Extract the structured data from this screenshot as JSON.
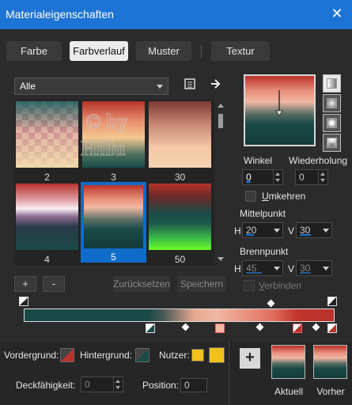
{
  "window": {
    "title": "Materialeigenschaften",
    "close_glyph": "✕"
  },
  "tabs": [
    {
      "label": "Farbe"
    },
    {
      "label": "Farbverlauf",
      "active": true
    },
    {
      "label": "Muster"
    },
    {
      "label": "Textur"
    }
  ],
  "category_select": {
    "value": "Alle"
  },
  "gallery": {
    "items": [
      {
        "label": "2"
      },
      {
        "label": "3"
      },
      {
        "label": "30"
      },
      {
        "label": "4"
      },
      {
        "label": "5",
        "selected": true
      },
      {
        "label": "50"
      }
    ],
    "watermark": "© by Hillu"
  },
  "buttons": {
    "add": "+",
    "remove": "-",
    "reset": "Zurücksetzen",
    "save": "Speichern"
  },
  "angle": {
    "label": "Winkel",
    "value": "0"
  },
  "repeat": {
    "label": "Wiederholung",
    "value": "0"
  },
  "invert": {
    "label": "Umkehren",
    "underline_char": "U",
    "rest": "mkehren"
  },
  "midpoint": {
    "label": "Mittelpunkt",
    "h_label": "H",
    "h_value": "20",
    "v_label": "V",
    "v_value": "30"
  },
  "focus": {
    "label": "Brennpunkt",
    "h_label": "H",
    "h_value": "45",
    "v_label": "V",
    "v_value": "30"
  },
  "link": {
    "label": "Verbinden",
    "underline_char": "V",
    "rest": "erbinden"
  },
  "bottom": {
    "foreground_label": "Vordergrund:",
    "background_label": "Hintergrund:",
    "user_label": "Nutzer:",
    "opacity_label": "Deckfähigkeit:",
    "opacity_value": "0",
    "position_label": "Position:",
    "position_value": "0",
    "current_label": "Aktuell",
    "previous_label": "Vorher",
    "plus": "+"
  },
  "colors": {
    "accent": "#1e74d4",
    "gradient_red": "#b8322b",
    "gradient_pink": "#f0b8a4",
    "gradient_teal": "#1a4a47",
    "user_yellow": "#f2c21a"
  },
  "icons": [
    "close-icon",
    "settings-icon",
    "arrow-right-icon",
    "chevron-down-icon"
  ]
}
